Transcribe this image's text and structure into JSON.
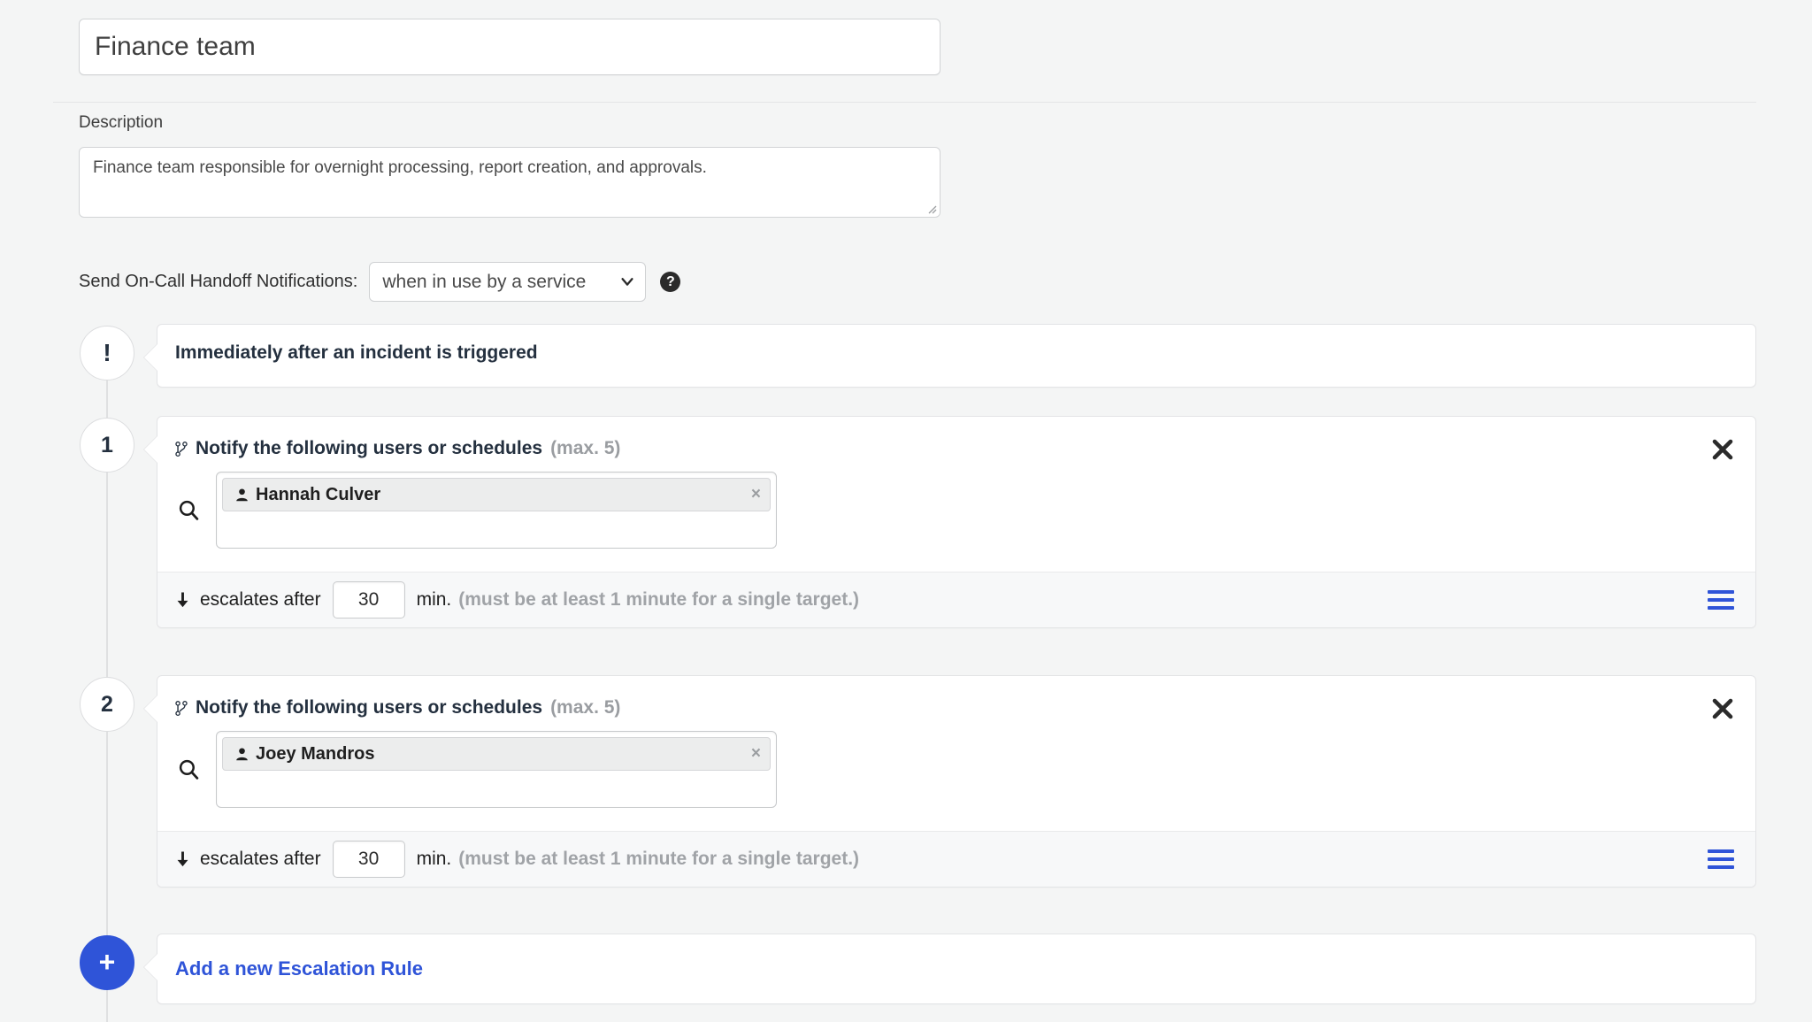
{
  "team": {
    "name": "Finance team",
    "description_label": "Description",
    "description": "Finance team responsible for overnight processing, report creation, and approvals."
  },
  "handoff": {
    "label": "Send On-Call Handoff Notifications:",
    "selected": "when in use by a service",
    "help_icon": "question-circle-icon",
    "caret_icon": "chevron-down-icon"
  },
  "escalation": {
    "trigger": {
      "node": "!",
      "title": "Immediately after an incident is triggered"
    },
    "rules": [
      {
        "node": "1",
        "icon": "code-branch-icon",
        "title": "Notify the following users or schedules",
        "max": "(max. 5)",
        "close_icon": "close-icon",
        "search_icon": "search-icon",
        "targets": [
          {
            "name": "Hannah Culver",
            "icon": "user-icon",
            "remove": "×"
          }
        ],
        "footer": {
          "arrow_icon": "arrow-down-icon",
          "prefix": "escalates after",
          "minutes": "30",
          "suffix": "min.",
          "hint": "(must be at least 1 minute for a single target.)",
          "drag_icon": "drag-handle-icon"
        }
      },
      {
        "node": "2",
        "icon": "code-branch-icon",
        "title": "Notify the following users or schedules",
        "max": "(max. 5)",
        "close_icon": "close-icon",
        "search_icon": "search-icon",
        "targets": [
          {
            "name": "Joey Mandros",
            "icon": "user-icon",
            "remove": "×"
          }
        ],
        "footer": {
          "arrow_icon": "arrow-down-icon",
          "prefix": "escalates after",
          "minutes": "30",
          "suffix": "min.",
          "hint": "(must be at least 1 minute for a single target.)",
          "drag_icon": "drag-handle-icon"
        }
      }
    ],
    "add_rule": {
      "node": "+",
      "label": "Add a new Escalation Rule"
    }
  },
  "colors": {
    "accent_blue": "#2f54d8",
    "page_bg": "#f4f5f5",
    "muted_text": "#9a9da1"
  }
}
